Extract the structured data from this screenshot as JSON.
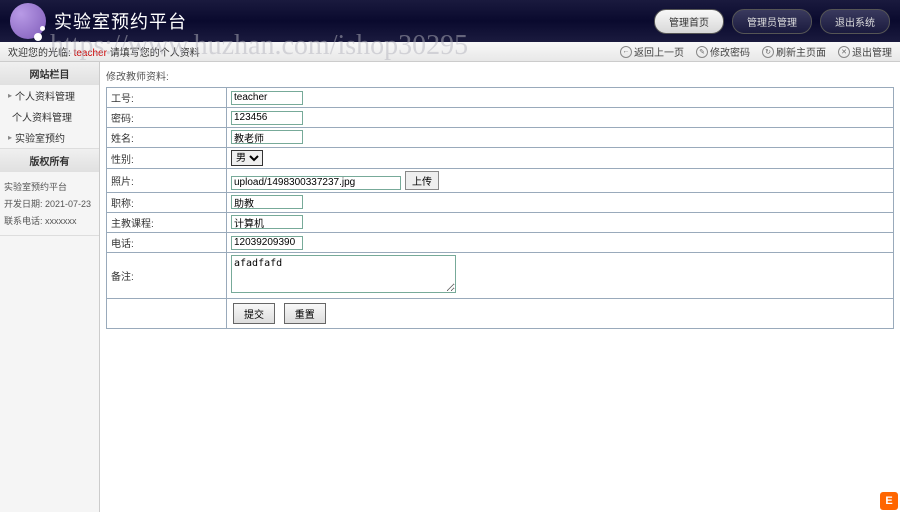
{
  "header": {
    "title": "实验室预约平台",
    "buttons": [
      {
        "label": "管理首页",
        "active": true
      },
      {
        "label": "管理员管理",
        "active": false
      },
      {
        "label": "退出系统",
        "active": false
      }
    ]
  },
  "watermark": "https://www.huzhan.com/ishop30295",
  "breadcrumb": {
    "welcome": "欢迎您的光临: ",
    "user": "teacher",
    "extra": " 请填写您的个人资料",
    "links": [
      "返回上一页",
      "修改密码",
      "刷新主页面",
      "退出管理"
    ]
  },
  "sidebar": {
    "section1_title": "网站栏目",
    "items": [
      {
        "label": "个人资料管理",
        "type": "parent"
      },
      {
        "label": "个人资料管理",
        "type": "child"
      },
      {
        "label": "实验室预约",
        "type": "parent"
      }
    ],
    "section2_title": "版权所有",
    "copyright": {
      "line1": "实验室预约平台",
      "line2": "开发日期: 2021-07-23",
      "line3": "联系电话: xxxxxxx"
    }
  },
  "form": {
    "title": "修改教师资料:",
    "fields": {
      "gonghao_label": "工号:",
      "gonghao_value": "teacher",
      "mima_label": "密码:",
      "mima_value": "123456",
      "xingming_label": "姓名:",
      "xingming_value": "教老师",
      "xingbie_label": "性别:",
      "xingbie_value": "男",
      "zhaopian_label": "照片:",
      "zhaopian_value": "upload/1498300337237.jpg",
      "upload_btn": "上传",
      "zhicheng_label": "职称:",
      "zhicheng_value": "助教",
      "kecheng_label": "主教课程:",
      "kecheng_value": "计算机",
      "dianhua_label": "电话:",
      "dianhua_value": "12039209390",
      "beizhu_label": "备注:",
      "beizhu_value": "afadfafd"
    },
    "submit": "提交",
    "reset": "重置"
  },
  "corner": "E"
}
